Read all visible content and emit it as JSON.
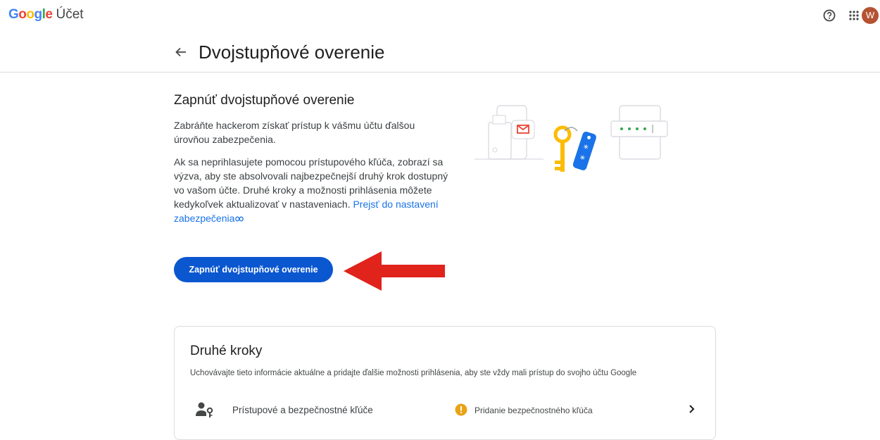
{
  "header": {
    "logo_letters": [
      "G",
      "o",
      "o",
      "g",
      "l",
      "e"
    ],
    "product": "Účet",
    "avatar_letter": "W",
    "icons": [
      "help-icon",
      "apps-grid-icon"
    ]
  },
  "page": {
    "title": "Dvojstupňové overenie"
  },
  "section": {
    "heading": "Zapnúť dvojstupňové overenie",
    "paragraph1": "Zabráňte hackerom získať prístup k vášmu účtu ďalšou úrovňou zabezpečenia.",
    "paragraph2": "Ak sa neprihlasujete pomocou prístupového kľúča, zobrazí sa výzva, aby ste absolvovali najbezpečnejší druhý krok dostupný vo vašom účte. Druhé kroky a možnosti prihlásenia môžete kedykoľvek aktualizovať v nastaveniach.",
    "link_text": "Prejsť do nastavení zabezpečenia",
    "button_label": "Zapnúť dvojstupňové overenie"
  },
  "colors": {
    "primary": "#0b57d0",
    "annotation_arrow": "#e0231b",
    "warning": "#e8a317",
    "link": "#1a73e8"
  },
  "card": {
    "title": "Druhé kroky",
    "subtitle": "Uchovávajte tieto informácie aktuálne a pridajte ďalšie možnosti prihlásenia, aby ste vždy mali prístup do svojho účtu Google",
    "rows": [
      {
        "label": "Prístupové a bezpečnostné kľúče",
        "status": "Pridanie bezpečnostného kľúča",
        "icon": "passkey-icon"
      }
    ]
  }
}
